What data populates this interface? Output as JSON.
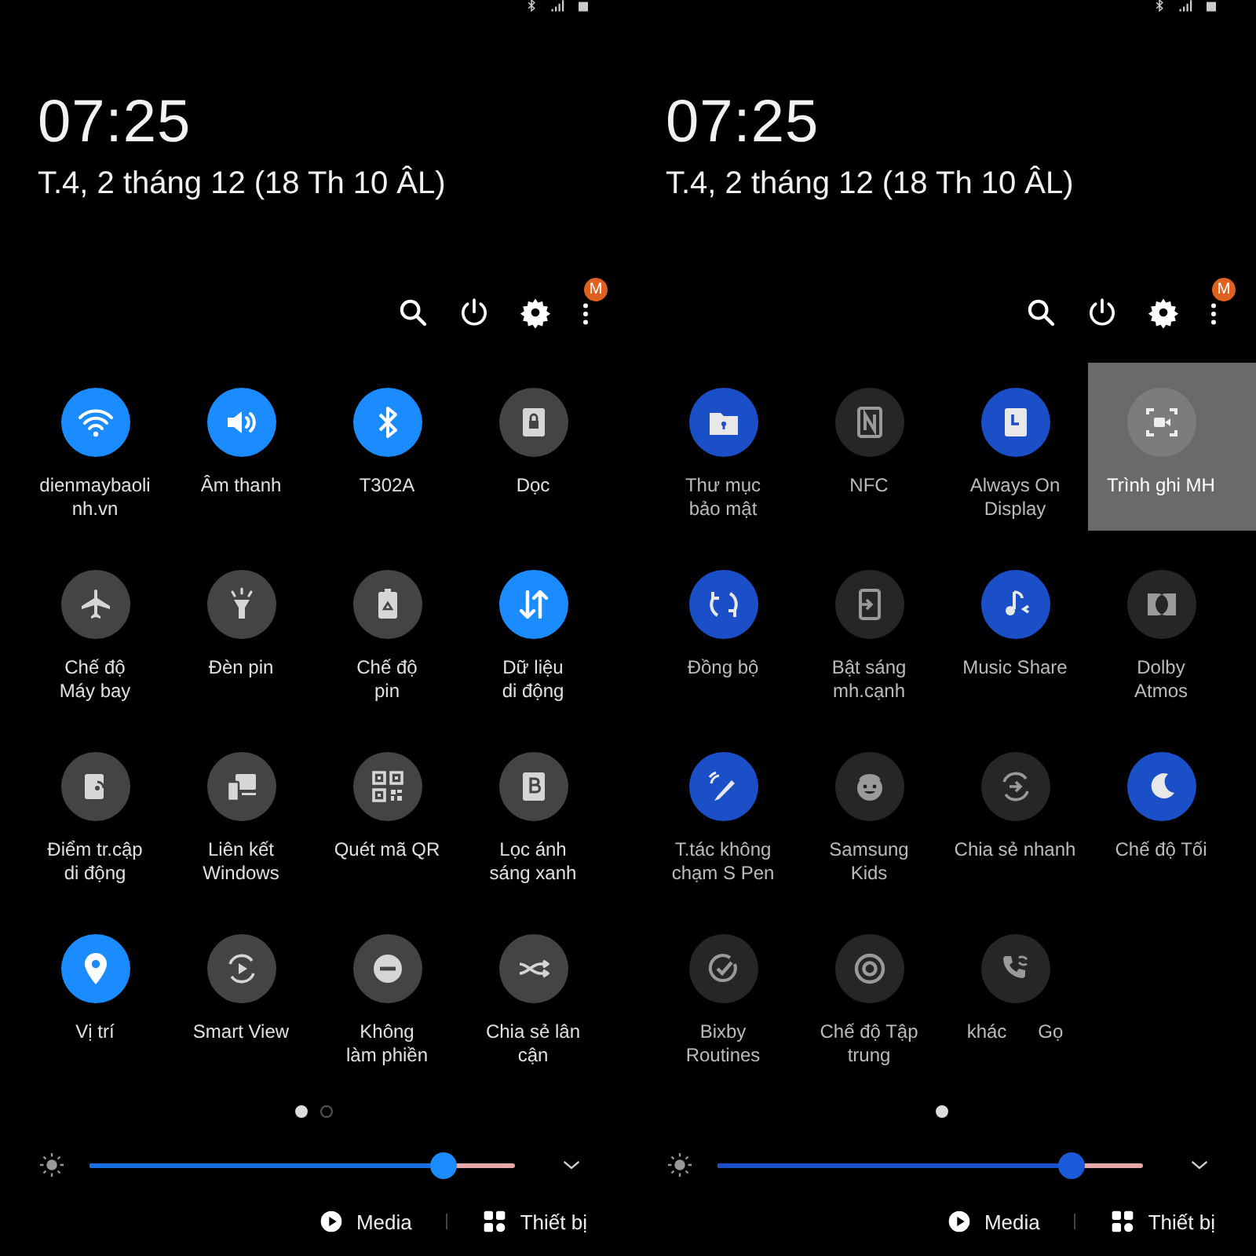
{
  "panels": [
    {
      "dimmed": false,
      "clock": "07:25",
      "date": "T.4, 2 tháng 12 (18 Th 10 ÂL)",
      "menu_badge": "M",
      "tiles": [
        {
          "label": "dienmaybaoli\nnh.vn",
          "on": true,
          "selected": false
        },
        {
          "label": "Âm thanh",
          "on": true,
          "selected": false
        },
        {
          "label": "T302A",
          "on": true,
          "selected": false
        },
        {
          "label": "Dọc",
          "on": false,
          "selected": false
        },
        {
          "label": "Chế độ\nMáy bay",
          "on": false,
          "selected": false
        },
        {
          "label": "Đèn pin",
          "on": false,
          "selected": false
        },
        {
          "label": "Chế độ\npin",
          "on": false,
          "selected": false
        },
        {
          "label": "Dữ liệu\ndi động",
          "on": true,
          "selected": false
        },
        {
          "label": "Điểm tr.cập\ndi động",
          "on": false,
          "selected": false
        },
        {
          "label": "Liên kết\nWindows",
          "on": false,
          "selected": false
        },
        {
          "label": "Quét mã QR",
          "on": false,
          "selected": false
        },
        {
          "label": "Lọc ánh\nsáng xanh",
          "on": false,
          "selected": false
        },
        {
          "label": "Vị trí",
          "on": true,
          "selected": false
        },
        {
          "label": "Smart View",
          "on": false,
          "selected": false
        },
        {
          "label": "Không\nlàm phiền",
          "on": false,
          "selected": false
        },
        {
          "label": "Chia sẻ lân\ncận",
          "on": false,
          "selected": false
        }
      ],
      "page_dots": [
        {
          "selected": true
        },
        {
          "selected": false
        }
      ],
      "brightness": {
        "level": 0.83
      },
      "media_label": "Media",
      "devices_label": "Thiết bị"
    },
    {
      "dimmed": true,
      "clock": "07:25",
      "date": "T.4, 2 tháng 12 (18 Th 10 ÂL)",
      "menu_badge": "M",
      "tiles": [
        {
          "label": "Thư mục\nbảo mật",
          "on": true,
          "selected": false
        },
        {
          "label": "NFC",
          "on": false,
          "selected": false
        },
        {
          "label": "Always On\nDisplay",
          "on": true,
          "selected": false
        },
        {
          "label": "Trình ghi MH",
          "on": false,
          "selected": true
        },
        {
          "label": "Đồng bộ",
          "on": true,
          "selected": false
        },
        {
          "label": "Bật sáng\nmh.cạnh",
          "on": false,
          "selected": false
        },
        {
          "label": "Music Share",
          "on": true,
          "selected": false
        },
        {
          "label": "Dolby\nAtmos",
          "on": false,
          "selected": false
        },
        {
          "label": "T.tác không\nchạm S Pen",
          "on": true,
          "selected": false
        },
        {
          "label": "Samsung\nKids",
          "on": false,
          "selected": false
        },
        {
          "label": "Chia sẻ nhanh",
          "on": false,
          "selected": false
        },
        {
          "label": "Chế độ Tối",
          "on": true,
          "selected": false
        },
        {
          "label": "Bixby\nRoutines",
          "on": false,
          "selected": false
        },
        {
          "label": "Chế độ Tập\ntrung",
          "on": false,
          "selected": false
        },
        {
          "label": "khác",
          "label_2": "Gọ",
          "on": false,
          "selected": false
        }
      ],
      "page_dots": [
        {
          "selected": true
        }
      ],
      "brightness": {
        "level": 0.83
      },
      "media_label": "Media",
      "devices_label": "Thiết bị"
    }
  ]
}
